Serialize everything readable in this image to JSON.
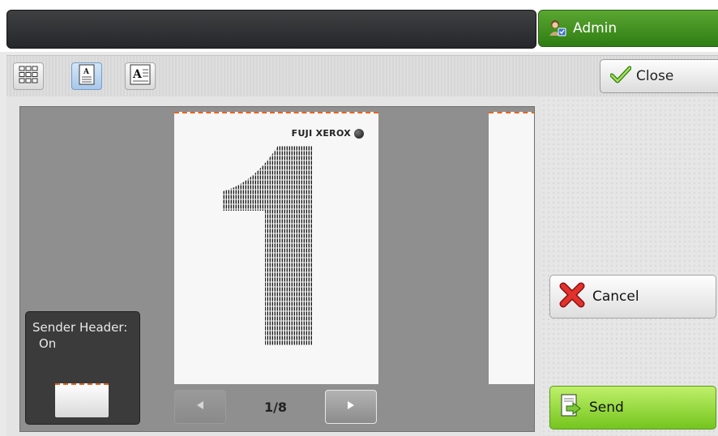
{
  "header": {
    "message": "",
    "user_label": "Admin",
    "user_icon": "admin-user-icon"
  },
  "toolbar": {
    "view_buttons": [
      {
        "name": "thumbnail-grid-view",
        "icon": "grid-icon",
        "active": false
      },
      {
        "name": "single-page-view",
        "icon": "page-view-icon",
        "active": true
      },
      {
        "name": "page-detail-view",
        "icon": "page-detail-icon",
        "active": false
      }
    ],
    "close_label": "Close",
    "close_icon": "checkmark-icon"
  },
  "preview": {
    "page_logo": "FUJI XEROX",
    "pager": {
      "current": "1/8",
      "prev_icon": "left-arrow-icon",
      "next_icon": "right-arrow-icon"
    },
    "sender_header": {
      "label": "Sender Header:",
      "value": "On"
    }
  },
  "actions": {
    "cancel_label": "Cancel",
    "cancel_icon": "red-x-icon",
    "send_label": "Send",
    "send_icon": "send-document-icon"
  },
  "colors": {
    "accent_green": "#2f7d13",
    "send_green": "#74c51e",
    "header_dash": "#e7641f"
  }
}
